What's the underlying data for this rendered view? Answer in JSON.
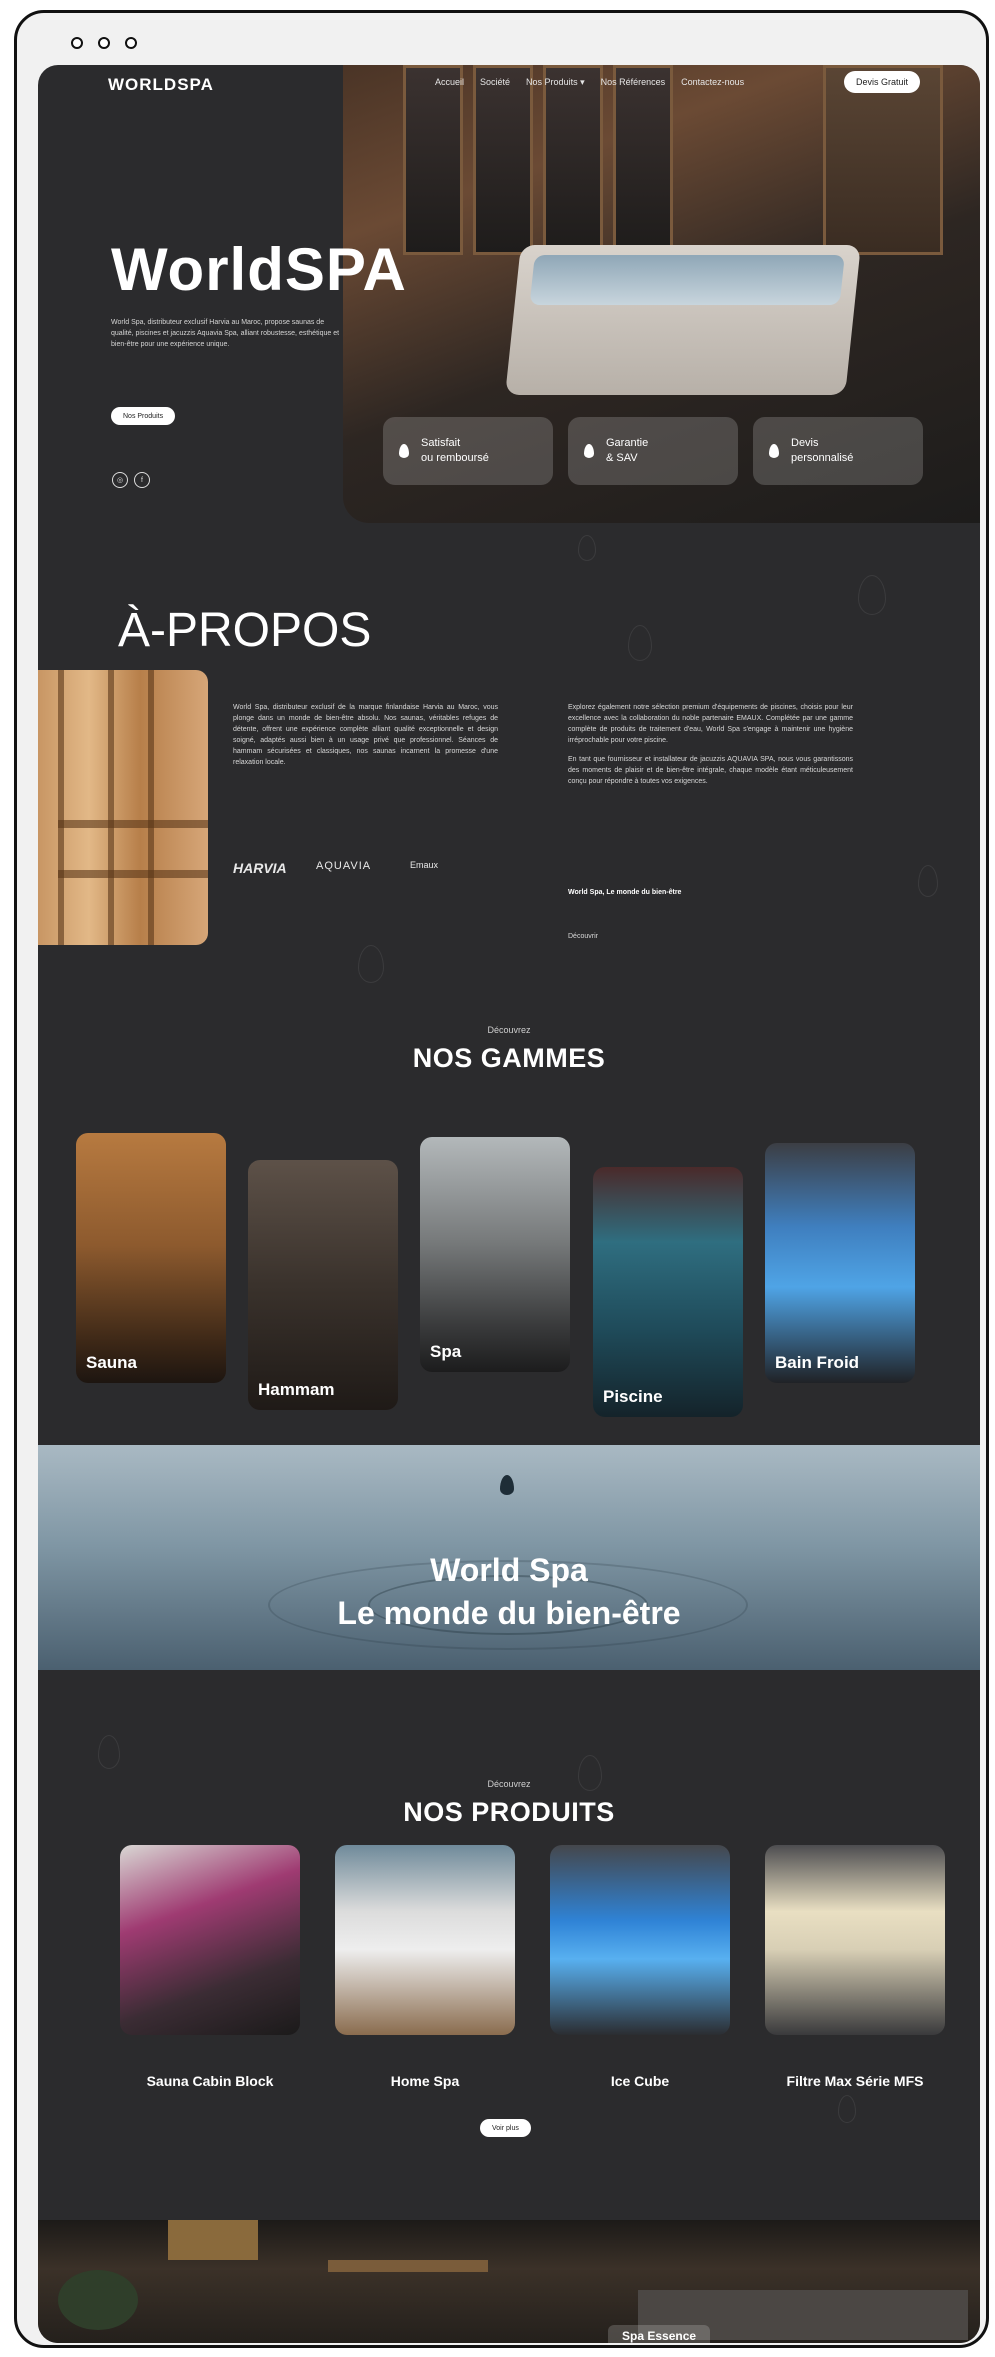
{
  "nav": {
    "logo": "WORLDSPA",
    "items": [
      "Accueil",
      "Société",
      "Nos Produits ▾",
      "Nos Références",
      "Contactez-nous"
    ],
    "cta": "Devis Gratuit"
  },
  "hero": {
    "title": "WorldSPA",
    "description": "World Spa, distributeur exclusif Harvia au Maroc, propose saunas de qualité, piscines et jacuzzis Aquavia Spa, alliant robustesse, esthétique et bien-être pour une expérience unique.",
    "button": "Nos Produits",
    "features": [
      {
        "line1": "Satisfait",
        "line2": "ou remboursé"
      },
      {
        "line1": "Garantie",
        "line2": "& SAV"
      },
      {
        "line1": "Devis",
        "line2": "personnalisé"
      }
    ]
  },
  "about": {
    "title": "À-PROPOS",
    "col1": "World Spa, distributeur exclusif de la marque finlandaise Harvia au Maroc, vous plonge dans un monde de bien-être absolu. Nos saunas, véritables refuges de détente, offrent une expérience complète alliant qualité exceptionnelle et design soigné, adaptés aussi bien à un usage privé que professionnel. Séances de hammam sécurisées et classiques, nos saunas incarnent la promesse d'une relaxation locale.",
    "col2_p1": "Explorez également notre sélection premium d'équipements de piscines, choisis pour leur excellence avec la collaboration du noble partenaire EMAUX. Complétée par une gamme complète de produits de traitement d'eau, World Spa s'engage à maintenir une hygiène irréprochable pour votre piscine.",
    "col2_p2": "En tant que fournisseur et installateur de jacuzzis AQUAVIA SPA, nous vous garantissons des moments de plaisir et de bien-être intégrale, chaque modèle étant méticuleusement conçu pour répondre à toutes vos exigences.",
    "tagline": "World Spa, Le monde du bien-être",
    "link": "Découvrir",
    "brands": [
      "HARVIA",
      "AQUAVIA",
      "Emaux"
    ]
  },
  "gammes": {
    "kicker": "Découvrez",
    "title": "NOS GAMMES",
    "items": [
      "Sauna",
      "Hammam",
      "Spa",
      "Piscine",
      "Bain Froid"
    ]
  },
  "banner": {
    "line1": "World Spa",
    "line2": "Le monde du bien-être"
  },
  "produits": {
    "kicker": "Découvrez",
    "title": "NOS PRODUITS",
    "items": [
      "Sauna Cabin Block",
      "Home Spa",
      "Ice Cube",
      "Filtre Max Série MFS"
    ],
    "button": "Voir plus"
  },
  "bottom": {
    "label": "Spa Essence"
  },
  "colors": {
    "background": "#2b2b2d",
    "accent": "#ffffff"
  }
}
